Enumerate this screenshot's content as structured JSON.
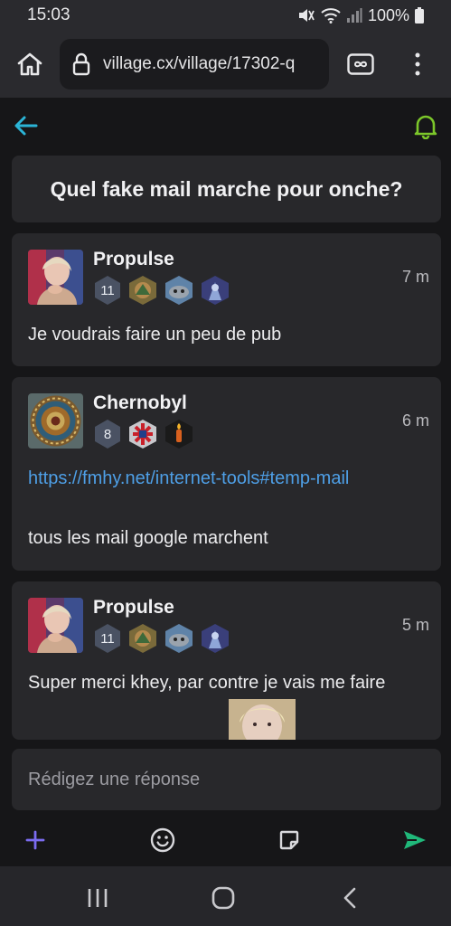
{
  "status": {
    "time": "15:03",
    "battery": "100%"
  },
  "browser": {
    "url": "village.cx/village/17302-q",
    "tab_count_icon": "infinity-icon"
  },
  "topic": {
    "title": "Quel fake mail marche pour onche?"
  },
  "posts": [
    {
      "author": "Propulse",
      "time": "7 m",
      "level": "11",
      "body": [
        "Je voudrais faire un peu de pub"
      ]
    },
    {
      "author": "Chernobyl",
      "time": "6 m",
      "level": "8",
      "link": "https://fmhy.net/internet-tools#temp-mail",
      "body": [
        "tous les mail google marchent"
      ]
    },
    {
      "author": "Propulse",
      "time": "5 m",
      "level": "11",
      "body": [
        "Super merci khey, par contre je vais me faire"
      ]
    }
  ],
  "reply": {
    "placeholder": "Rédigez une réponse"
  },
  "colors": {
    "accent_cyan": "#2bb4d6",
    "bell_green": "#7cc72a",
    "send_green": "#20b87a",
    "plus_purple": "#7b6cf0",
    "link_blue": "#4e9fe6"
  }
}
